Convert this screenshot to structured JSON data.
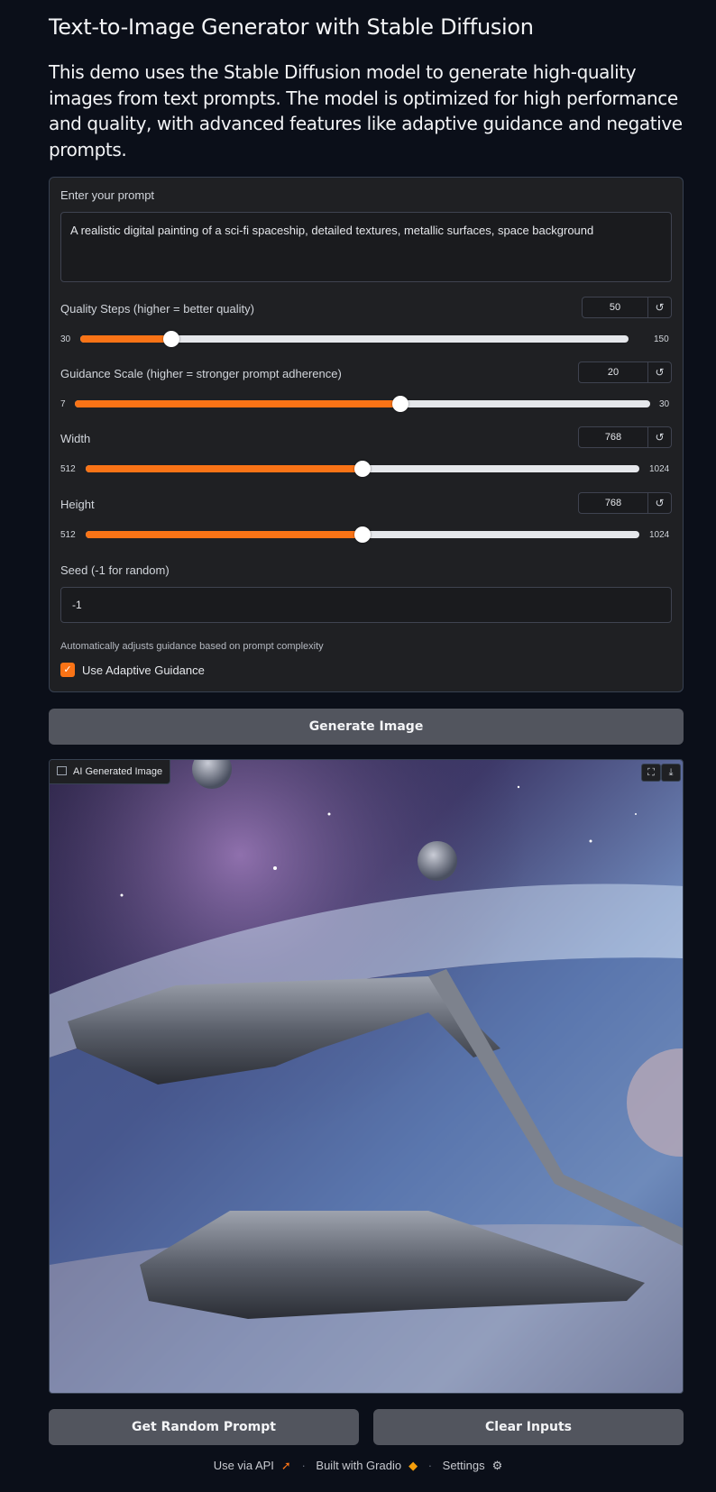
{
  "header": {
    "title": "Text-to-Image Generator with Stable Diffusion",
    "description": "This demo uses the Stable Diffusion model to generate high-quality images from text prompts. The model is optimized for high performance and quality, with advanced features like adaptive guidance and negative prompts."
  },
  "prompt": {
    "label": "Enter your prompt",
    "value": "A realistic digital painting of a sci-fi spaceship, detailed textures, metallic surfaces, space background"
  },
  "sliders": {
    "steps": {
      "label": "Quality Steps (higher = better quality)",
      "value": "50",
      "min": "30",
      "max": "150",
      "fraction": 0.1667
    },
    "guidance": {
      "label": "Guidance Scale (higher = stronger prompt adherence)",
      "value": "20",
      "min": "7",
      "max": "30",
      "fraction": 0.5652
    },
    "width": {
      "label": "Width",
      "value": "768",
      "min": "512",
      "max": "1024",
      "fraction": 0.5
    },
    "height": {
      "label": "Height",
      "value": "768",
      "min": "512",
      "max": "1024",
      "fraction": 0.5
    },
    "reset_icon": "↺"
  },
  "seed": {
    "label": "Seed (-1 for random)",
    "value": "-1"
  },
  "adaptive": {
    "info": "Automatically adjusts guidance based on prompt complexity",
    "label": "Use Adaptive Guidance",
    "checked": true
  },
  "buttons": {
    "generate": "Generate Image",
    "random": "Get Random Prompt",
    "clear": "Clear Inputs"
  },
  "output": {
    "label": "AI Generated Image",
    "fullscreen_icon": "⛶",
    "download_icon": "⤓"
  },
  "footer": {
    "api": "Use via API",
    "gradio": "Built with Gradio",
    "settings": "Settings"
  },
  "colors": {
    "accent": "#f97316",
    "background": "#0b0f19",
    "panel": "#1f2023",
    "button": "#52555e"
  }
}
